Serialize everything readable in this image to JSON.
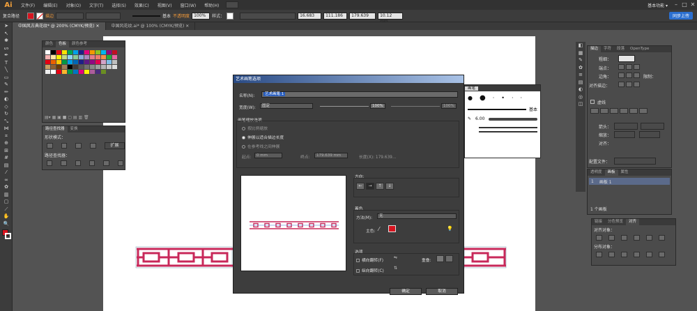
{
  "menubar": {
    "logo": "Ai",
    "items": [
      "文件(F)",
      "编辑(E)",
      "对象(O)",
      "文字(T)",
      "选择(S)",
      "效果(C)",
      "视图(V)",
      "窗口(W)",
      "帮助(H)"
    ],
    "workspace": "基本功能 ▾",
    "min": "–",
    "max": "□",
    "close": "✕"
  },
  "controlbar": {
    "mode": "复合路径",
    "stroke_label": "描边",
    "style_name": "基本",
    "opacity_label": "不透明度",
    "opacity": "100%",
    "style_label": "样式：",
    "x": "16.683",
    "y": "111.186",
    "w": "179.639",
    "h": "10.12 mm",
    "cloud": "同步上传",
    "fill_color": "#d7141f"
  },
  "tabs": [
    {
      "label": "中国风古典花纹* @ 200% (CMYK/预览)",
      "close": "✕"
    },
    {
      "label": "中国风花纹.ai* @ 100% (CMYK/预览)",
      "close": "✕"
    }
  ],
  "swatches_panel": {
    "tabs": [
      "颜色",
      "色板",
      "颜色参考"
    ],
    "colors": [
      "#ffffff",
      "#000000",
      "#e20a16",
      "#f7e200",
      "#00a54f",
      "#00a0e9",
      "#1d2087",
      "#e4007f",
      "#f39800",
      "#8fc31f",
      "#00b7ee",
      "#920783",
      "#c30d23",
      "#f5b3b2",
      "#fce4a2",
      "#fff100",
      "#c1db81",
      "#8fd3f5",
      "#89c997",
      "#88abda",
      "#aa89bd",
      "#e67a8a",
      "#ee7c6b",
      "#f19149",
      "#22ac38",
      "#ea68a2",
      "#e60012",
      "#eb6100",
      "#fcc800",
      "#009944",
      "#00a0e9",
      "#0068b7",
      "#1d2088",
      "#601986",
      "#920783",
      "#e5004f",
      "#d3a4c8",
      "#7fbfe8",
      "#bfbfbf",
      "#c9a063",
      "#8f5f30",
      "#6a3906",
      "#a07c56",
      "#000000",
      "#3e3a39",
      "#595757",
      "#727171",
      "#898989",
      "#9fa0a0",
      "#b5b5b6",
      "#c9caca",
      "#dcdddd",
      "#efefef",
      "#ffffff",
      "#e60012",
      "#f8b62d",
      "#009944",
      "#0075c2",
      "#e4007f",
      "#fff100",
      "#ae5e9b",
      "#4a2d7c",
      "#6b8e23"
    ]
  },
  "pathfinder": {
    "tabs": [
      "路径查找器",
      "变换"
    ],
    "shape_modes_label": "形状模式：",
    "expand": "扩展",
    "pathfinders_label": "路径查找器："
  },
  "stroke_panel": {
    "tabs": [
      "描边",
      "字符",
      "段落",
      "OpenType"
    ],
    "weight_label": "粗细：",
    "cap_label": "端点：",
    "corner_label": "边角：",
    "limit_label": "限制：",
    "align_label": "对齐描边：",
    "dashed": "虚线",
    "arrow_label": "箭头：",
    "scale_label": "缩放：",
    "align2_label": "对齐：",
    "profile_label": "配置文件："
  },
  "layers_panel": {
    "tabs": [
      "透明度",
      "画板",
      "属性"
    ],
    "row_index": "1",
    "row_name": "画板 1",
    "count": "1 个画板"
  },
  "align_panel": {
    "tabs": [
      "链接",
      "分色预览",
      "对齐"
    ],
    "align_objects": "对齐对象：",
    "distribute_objects": "分布对象："
  },
  "brush_panel": {
    "title": "画笔",
    "basic": "基本",
    "size": "6.00"
  },
  "dialog": {
    "title": "艺术画笔选项",
    "name_label": "名称(N):",
    "name_value": "艺术画笔 1",
    "width_label": "宽度(W):",
    "width_mode": "固定",
    "width_value": "100%",
    "width_value2": "100%",
    "scale_title": "画笔缩放选项",
    "opt1": "按比例缩放",
    "opt2": "伸展以适合描边长度",
    "opt3": "在参考线之间伸展",
    "start_label": "起点:",
    "start_value": "0 mm",
    "end_label": "终点:",
    "end_value": "179.639 mm",
    "length_label": "长度(X): 179.639...",
    "direction_label": "方向:",
    "color_title": "着色",
    "method_label": "方法(M):",
    "method_value": "无",
    "key_color_label": "主色:",
    "options_title": "选项",
    "flip_h": "横向翻转(F)",
    "flip_v": "纵向翻转(C)",
    "overlap_label": "重叠:",
    "ok": "确定",
    "cancel": "取消",
    "key_color": "#d7141f",
    "pattern_color": "#c8285a"
  }
}
